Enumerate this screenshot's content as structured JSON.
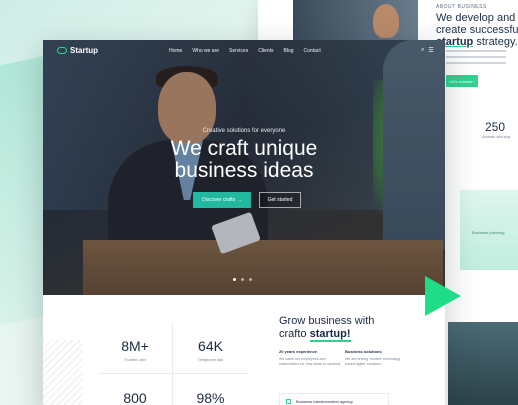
{
  "back_page": {
    "eyebrow": "ABOUT BUSINESS",
    "title_line1": "We develop and",
    "title_line2": "create successful",
    "title_accent": "startup",
    "title_end": "strategy.",
    "button_label": "Let's connect ›",
    "stat_value": "250",
    "stat_label": "Awards winning",
    "card_label": "Business planning"
  },
  "nav": {
    "logo": "Startup",
    "items": [
      "Home",
      "Who we are",
      "Services",
      "Clients",
      "Blog",
      "Contact"
    ]
  },
  "hero": {
    "eyebrow": "Creative solutions for everyone",
    "title_line1": "We craft unique",
    "title_line2": "business ideas",
    "primary_button": "Discover crafto →",
    "secondary_button": "Get started"
  },
  "stats": [
    {
      "value": "8M+",
      "label": "Trusted user"
    },
    {
      "value": "64K",
      "label": "Telephone talk"
    },
    {
      "value": "800",
      "label": ""
    },
    {
      "value": "98%",
      "label": ""
    }
  ],
  "grow": {
    "title": "Grow business with",
    "title_brand": "crafto",
    "title_accent": "startup!",
    "features": [
      {
        "title": "20 years experience",
        "desc": "We value our employees and stakeholders for new ideas or opinions."
      },
      {
        "title": "Business solutions",
        "desc": "We are driving 'modern technology based digital' solutions."
      }
    ],
    "card_label": "Business transformation agency"
  },
  "colors": {
    "accent_green": "#2fd38d",
    "button_teal": "#21b9a0",
    "text_dark": "#1b2b44"
  }
}
